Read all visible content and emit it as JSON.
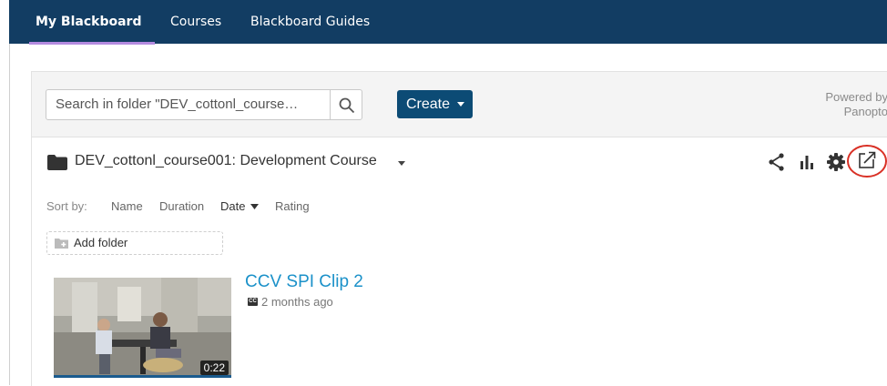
{
  "nav": {
    "tabs": [
      {
        "label": "My Blackboard",
        "active": true
      },
      {
        "label": "Courses",
        "active": false
      },
      {
        "label": "Blackboard Guides",
        "active": false
      }
    ]
  },
  "search": {
    "value": "Search in folder \"DEV_cottonl_course…",
    "icon": "search-icon"
  },
  "create": {
    "label": "Create",
    "icon": "chevron-down-icon"
  },
  "powered_by": {
    "line1": "Powered by",
    "line2": "Panopto"
  },
  "folder": {
    "name": "DEV_cottonl_course001: Development Course",
    "icon": "folder-icon",
    "tools": [
      "share-icon",
      "stats-icon",
      "settings-icon",
      "open-external-icon"
    ],
    "highlighted_tool": "open-external-icon",
    "highlight_color": "#d93025"
  },
  "sort": {
    "label": "Sort by:",
    "options": [
      "Name",
      "Duration",
      "Date",
      "Rating"
    ],
    "active": "Date"
  },
  "add_folder": {
    "label": "Add folder"
  },
  "session": {
    "title": "CCV SPI Clip 2",
    "cc": "CC",
    "age": "2 months ago",
    "duration": "0:22"
  },
  "colors": {
    "nav_bg": "#123d63",
    "active_tab_underline": "#b48be0",
    "create_bg": "#0c4b75",
    "link": "#1b91c9"
  }
}
